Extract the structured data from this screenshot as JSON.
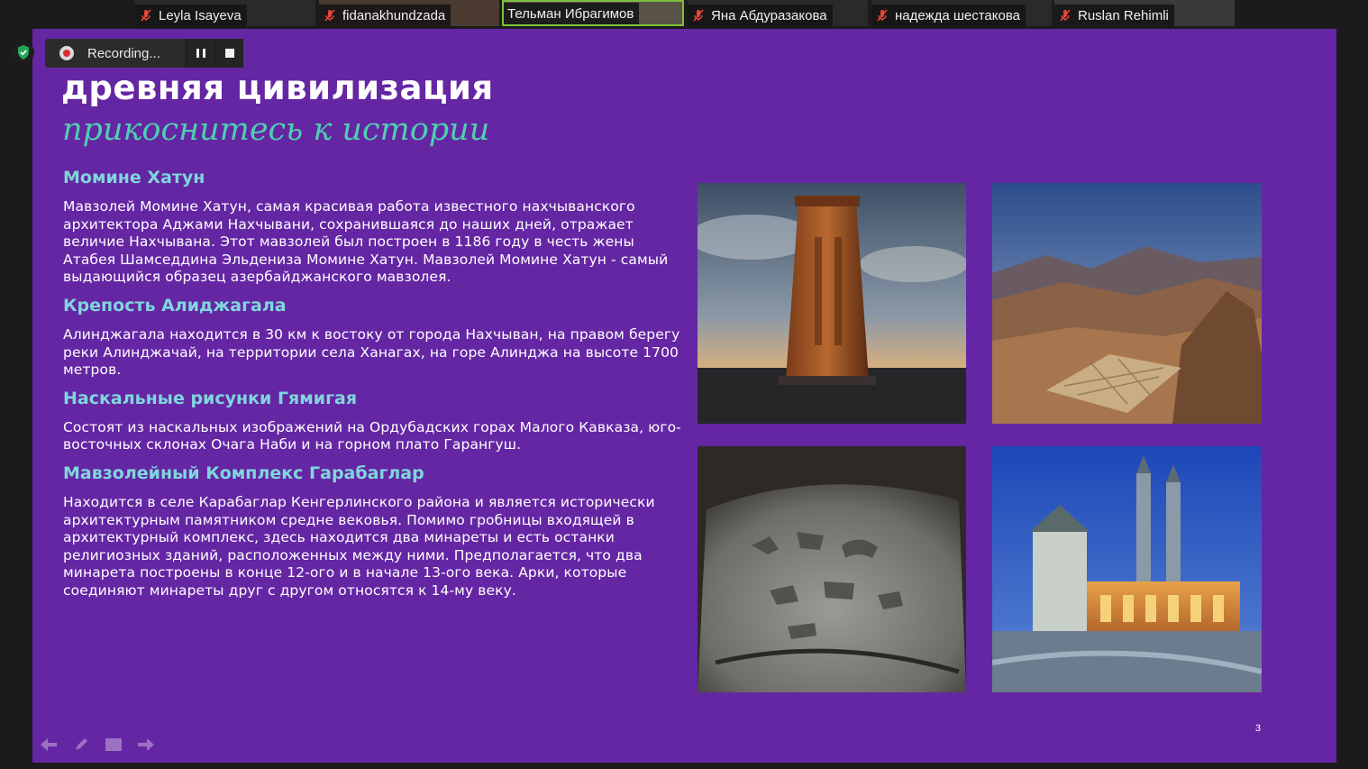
{
  "participants": [
    {
      "name": "Leyla Isayeva"
    },
    {
      "name": "fidanakhundzada"
    },
    {
      "name": "Тельман Ибрагимов"
    },
    {
      "name": "Яна Абдуразакова"
    },
    {
      "name": "надежда шестакова"
    },
    {
      "name": "Ruslan Rehimli"
    }
  ],
  "recording": {
    "label": "Recording..."
  },
  "slide": {
    "title": "древняя цивилизация",
    "subtitle": "прикоснитесь к истории",
    "sections": [
      {
        "heading": "Момине Хатун",
        "text": "Мавзолей Момине Хатун, самая красивая работа известного нахчыванского архитектора Аджами Нахчывани, сохранившаяся до наших дней, отражает величие Нахчывана. Этот мавзолей был построен в 1186 году в честь жены Атабея Шамседдина Эльдениза Момине Хатун. Мавзолей Момине Хатун - самый выдающийся образец азербайджанского  мавзолея."
      },
      {
        "heading": "Крепость Алиджагала",
        "text": "Алинджагала находится в 30 км к востоку от города Нахчыван, на правом берегу реки Алинджачай, на территории села Ханагах, на горе Алинджа на высоте  1700 метров."
      },
      {
        "heading": "Наскальные рисунки Гямигая",
        "text": "Состоят из наскальных изображений  на Ордубадских горах Малого Кавказа,  юго-восточных склонах Очага Наби и на горном плато Гарангуш."
      },
      {
        "heading": "Мавзолейный Комплекс Гарабаглар",
        "text": "Находится в селе Карабаглар Кенгерлинского района и является исторически архитектурным памятником средне вековья. Помимо гробницы входящей в архитектурный комплекс, здесь находится два минареты и есть останки религиозных зданий, расположенных между ними. Предполагается, что два минарета построены в конце 12-ого и в начале 13-ого века. Арки, которые соединяют минареты друг с другом относятся к 14-му веку."
      }
    ],
    "page_number": "3"
  },
  "colors": {
    "slide_bg": "#6526a4",
    "heading": "#7fd6dc",
    "subtitle": "#4fcfb0"
  }
}
